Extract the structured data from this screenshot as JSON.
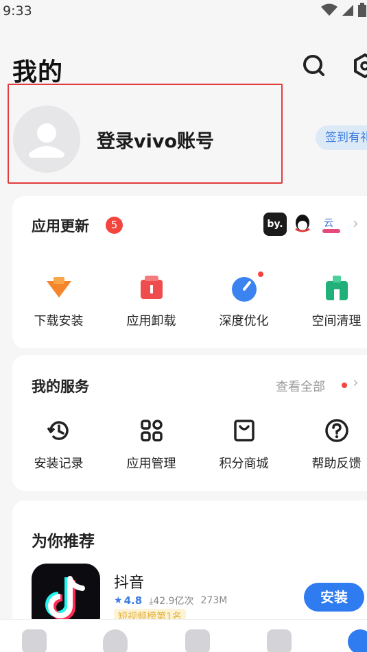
{
  "status": {
    "time": "9:33"
  },
  "header": {
    "title": "我的"
  },
  "account": {
    "login_text": "登录vivo账号",
    "checkin_label": "签到有礼"
  },
  "updates": {
    "title": "应用更新",
    "badge_count": "5",
    "mini_apps": [
      {
        "icon": "by-app-icon",
        "text": "by."
      },
      {
        "icon": "qq-icon",
        "text": ""
      },
      {
        "icon": "cloud-app-icon",
        "text": ""
      }
    ],
    "actions": [
      {
        "label": "下载安装",
        "icon": "download-icon",
        "color": "#f5852a"
      },
      {
        "label": "应用卸载",
        "icon": "uninstall-icon",
        "color": "#ef4d4d"
      },
      {
        "label": "深度优化",
        "icon": "optimize-icon",
        "color": "#3b83f0"
      },
      {
        "label": "空间清理",
        "icon": "clean-icon",
        "color": "#22b07a"
      }
    ]
  },
  "services": {
    "title": "我的服务",
    "see_all": "查看全部",
    "items": [
      {
        "label": "安装记录",
        "icon": "history-icon"
      },
      {
        "label": "应用管理",
        "icon": "app-manage-icon"
      },
      {
        "label": "积分商城",
        "icon": "points-mall-icon"
      },
      {
        "label": "帮助反馈",
        "icon": "help-icon"
      }
    ]
  },
  "recommend": {
    "title": "为你推荐",
    "app": {
      "name": "抖音",
      "rating": "4.8",
      "downloads": "42.9亿次",
      "size": "273M",
      "tag": "短视频榜第1名",
      "install_label": "安装"
    }
  },
  "bottom_nav": [
    "home-icon",
    "app-store-icon",
    "game-icon",
    "category-icon",
    "my-icon"
  ]
}
